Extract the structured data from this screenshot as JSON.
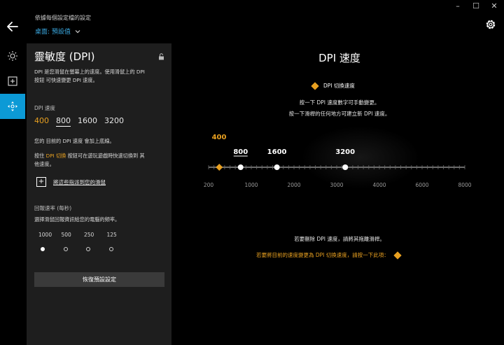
{
  "window": {
    "minimize": "–",
    "maximize": "☐",
    "close": "✕"
  },
  "header": {
    "subtitle": "依據每個設定檔的設定",
    "profile": "桌面: 預設值"
  },
  "rail": {
    "items": [
      {
        "icon": "sun-icon",
        "active": false
      },
      {
        "icon": "plus-square-icon",
        "active": false
      },
      {
        "icon": "move-arrows-icon",
        "active": true
      }
    ]
  },
  "panel": {
    "title": "靈敏度 (DPI)",
    "desc1_line1": "DPI 是您滑鼠在螢幕上的速度。使用滑鼠上的 DPI",
    "desc1_line2": "按鈕 可快速變更 DPI 速度。",
    "dpi_label": "DPI 速度",
    "dpi_values": [
      "400",
      "800",
      "1600",
      "3200"
    ],
    "shift_note": "您的 目前的 DPI 速度 會加上底線。",
    "shift_pre": "按住 ",
    "shift_key": "DPI 切換",
    "shift_post": " 按鈕可在遊玩遊戲時快速切換到 其",
    "shift_line2": "他速度。",
    "assign_label": "將這些指派到您的滑鼠",
    "rate_label": "回報速率 (每秒)",
    "rate_desc": "選擇滑鼠回報資訊給您的電腦的頻率。",
    "rates": [
      "1000",
      "500",
      "250",
      "125"
    ],
    "rate_selected": "1000",
    "reset_label": "恢復預設設定"
  },
  "main": {
    "title": "DPI 速度",
    "legend": "DPI 切換速度",
    "hint1": "按一下 DPI 速度數字可手動變更。",
    "hint2": "按一下滑桿的任何地方可建立新 DPI 速度。",
    "delete_hint": "若要刪除 DPI 速度，請將其拖離滑桿。",
    "shift_hint": "若要將目前的速度變更為 DPI 切換速度，請按一下此項：",
    "slider": {
      "min": 200,
      "max": 8000,
      "ticks": [
        "200",
        "1000",
        "2000",
        "3000",
        "4000",
        "6000",
        "8000"
      ],
      "shift_value": "400",
      "points": [
        "800",
        "1600",
        "3200"
      ],
      "current": "800"
    }
  },
  "colors": {
    "accent": "#e8a020",
    "active_blue": "#0c9ad6",
    "link_blue": "#3aa8e0",
    "panel_bg": "#1e1e1e"
  }
}
